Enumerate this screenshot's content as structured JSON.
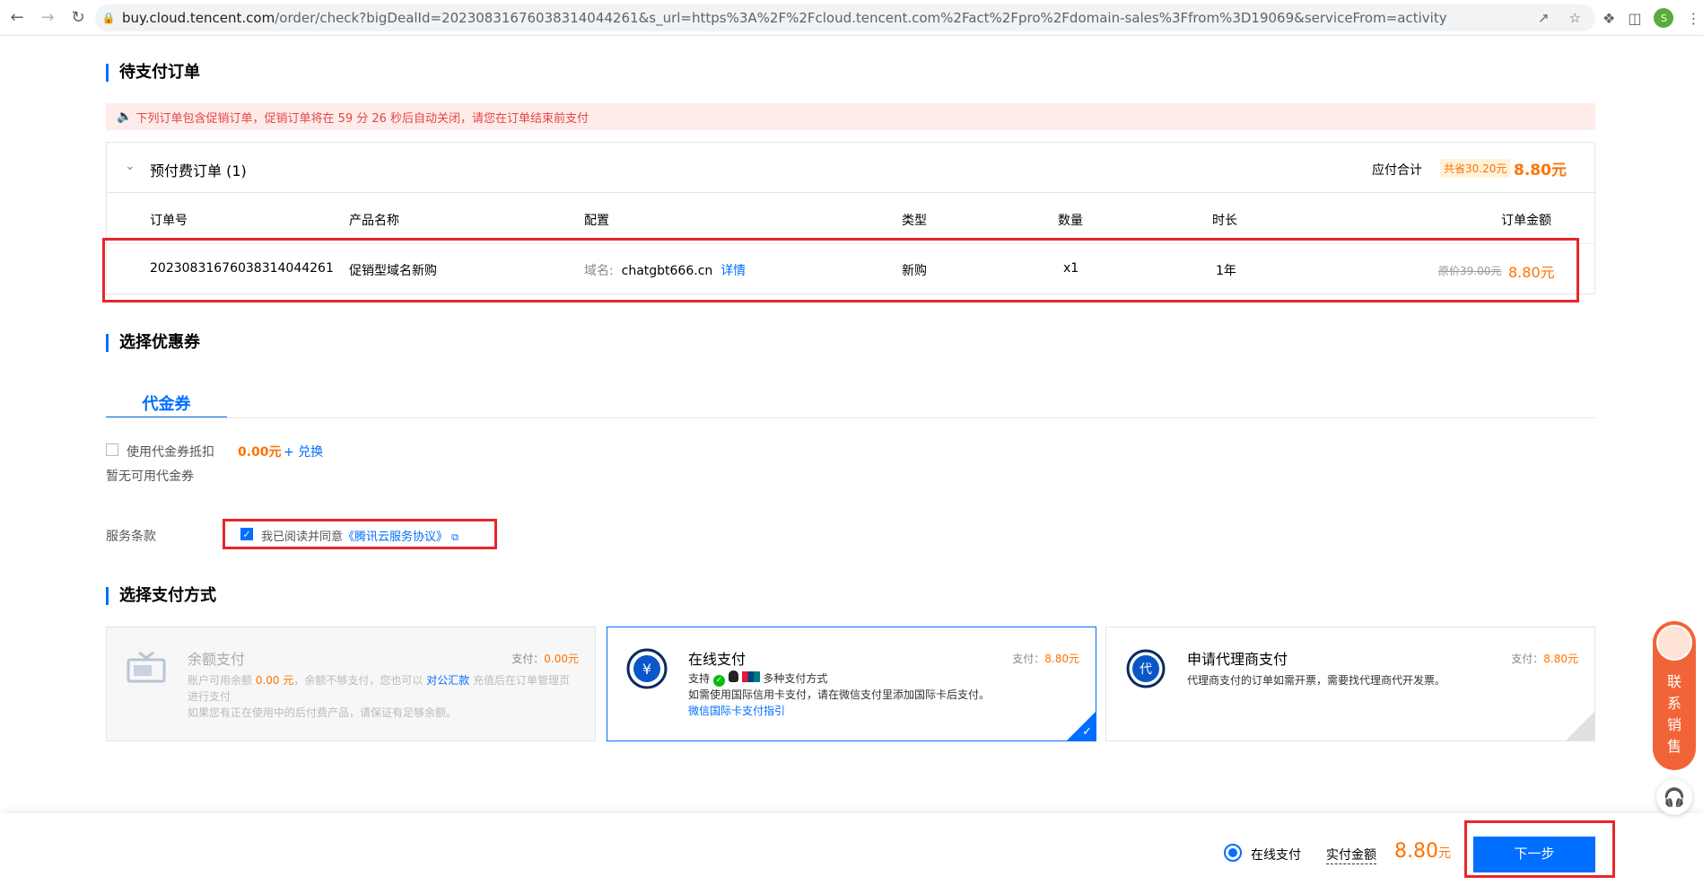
{
  "browser": {
    "url_host": "buy.cloud.tencent.com",
    "url_rest": "/order/check?bigDealId=20230831676038314044261&s_url=https%3A%2F%2Fcloud.tencent.com%2Fact%2Fpro%2Fdomain-sales%3Ffrom%3D19069&serviceFrom=activity",
    "profile_initial": "S"
  },
  "pending": {
    "section_title": "待支付订单",
    "notice": "下列订单包含促销订单，促销订单将在 59 分 26 秒后自动关闭，请您在订单结束前支付",
    "group_title": "预付费订单 (1)",
    "due_label": "应付合计",
    "save_badge": "共省30.20元",
    "due_amount": "8.80元",
    "columns": [
      "订单号",
      "产品名称",
      "配置",
      "类型",
      "数量",
      "时长",
      "订单金额"
    ],
    "row": {
      "order_no": "20230831676038314044261",
      "product": "促销型域名新购",
      "config_label": "域名:",
      "config_value": "chatgbt666.cn",
      "detail_link": "详情",
      "type": "新购",
      "qty": "x1",
      "duration": "1年",
      "original_price": "原价39.00元",
      "amount": "8.80元"
    }
  },
  "coupon": {
    "section_title": "选择优惠券",
    "tab": "代金券",
    "use_label": "使用代金券抵扣",
    "use_amount": "0.00元",
    "exchange": "+ 兑换",
    "empty": "暂无可用代金券"
  },
  "terms": {
    "label": "服务条款",
    "agree_text": "我已阅读并同意",
    "agreement_link": "《腾讯云服务协议》",
    "checked": true
  },
  "payment": {
    "section_title": "选择支付方式",
    "methods": [
      {
        "title": "余额支付",
        "pay_label": "支付：",
        "pay_amount": "0.00元",
        "desc_1": "账户可用余额 ",
        "desc_balance": "0.00 元",
        "desc_2": "，余额不够支付，您也可以 ",
        "desc_link": "对公汇款",
        "desc_3": " 充值后在订单管理页进行支付",
        "desc_4": "如果您有正在使用中的后付费产品，请保证有足够余额。",
        "icon": "wallet-icon"
      },
      {
        "title": "在线支付",
        "pay_label": "支付：",
        "pay_amount": "8.80元",
        "support": "支持",
        "multi": "多种支付方式",
        "desc": "如需使用国际信用卡支付，请在微信支付里添加国际卡后支付。",
        "link": "微信国际卡支付指引",
        "icon": "yuan-icon"
      },
      {
        "title": "申请代理商支付",
        "pay_label": "支付：",
        "pay_amount": "8.80元",
        "desc": "代理商支付的订单如需开票，需要找代理商代开发票。",
        "icon": "agent-icon"
      }
    ]
  },
  "bottom": {
    "method": "在线支付",
    "actual_label": "实付金额",
    "amount": "8.80",
    "unit": "元",
    "next": "下一步"
  },
  "side": {
    "sales": [
      "联",
      "系",
      "销",
      "售"
    ]
  },
  "colors": {
    "accent": "#006eff",
    "price": "#ff7200",
    "highlight_box": "#e8262a",
    "notice_bg": "#fdecea"
  }
}
